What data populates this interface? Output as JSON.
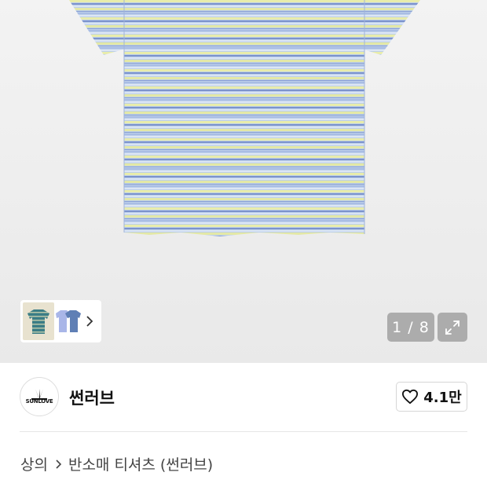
{
  "gallery": {
    "counter": "1 / 8",
    "colors": {
      "stripe_blue": "#7f97cf",
      "stripe_yellow": "#e6eaa4",
      "stripe_light": "#c2d2ea",
      "base": "#b8cde9"
    }
  },
  "brand": {
    "logo_text": "SUNLOVE",
    "name": "썬러브"
  },
  "like": {
    "icon": "heart-icon",
    "count": "4.1만"
  },
  "breadcrumb": {
    "category": "상의",
    "subcategory": "반소매 티셔츠 (썬러브)"
  }
}
